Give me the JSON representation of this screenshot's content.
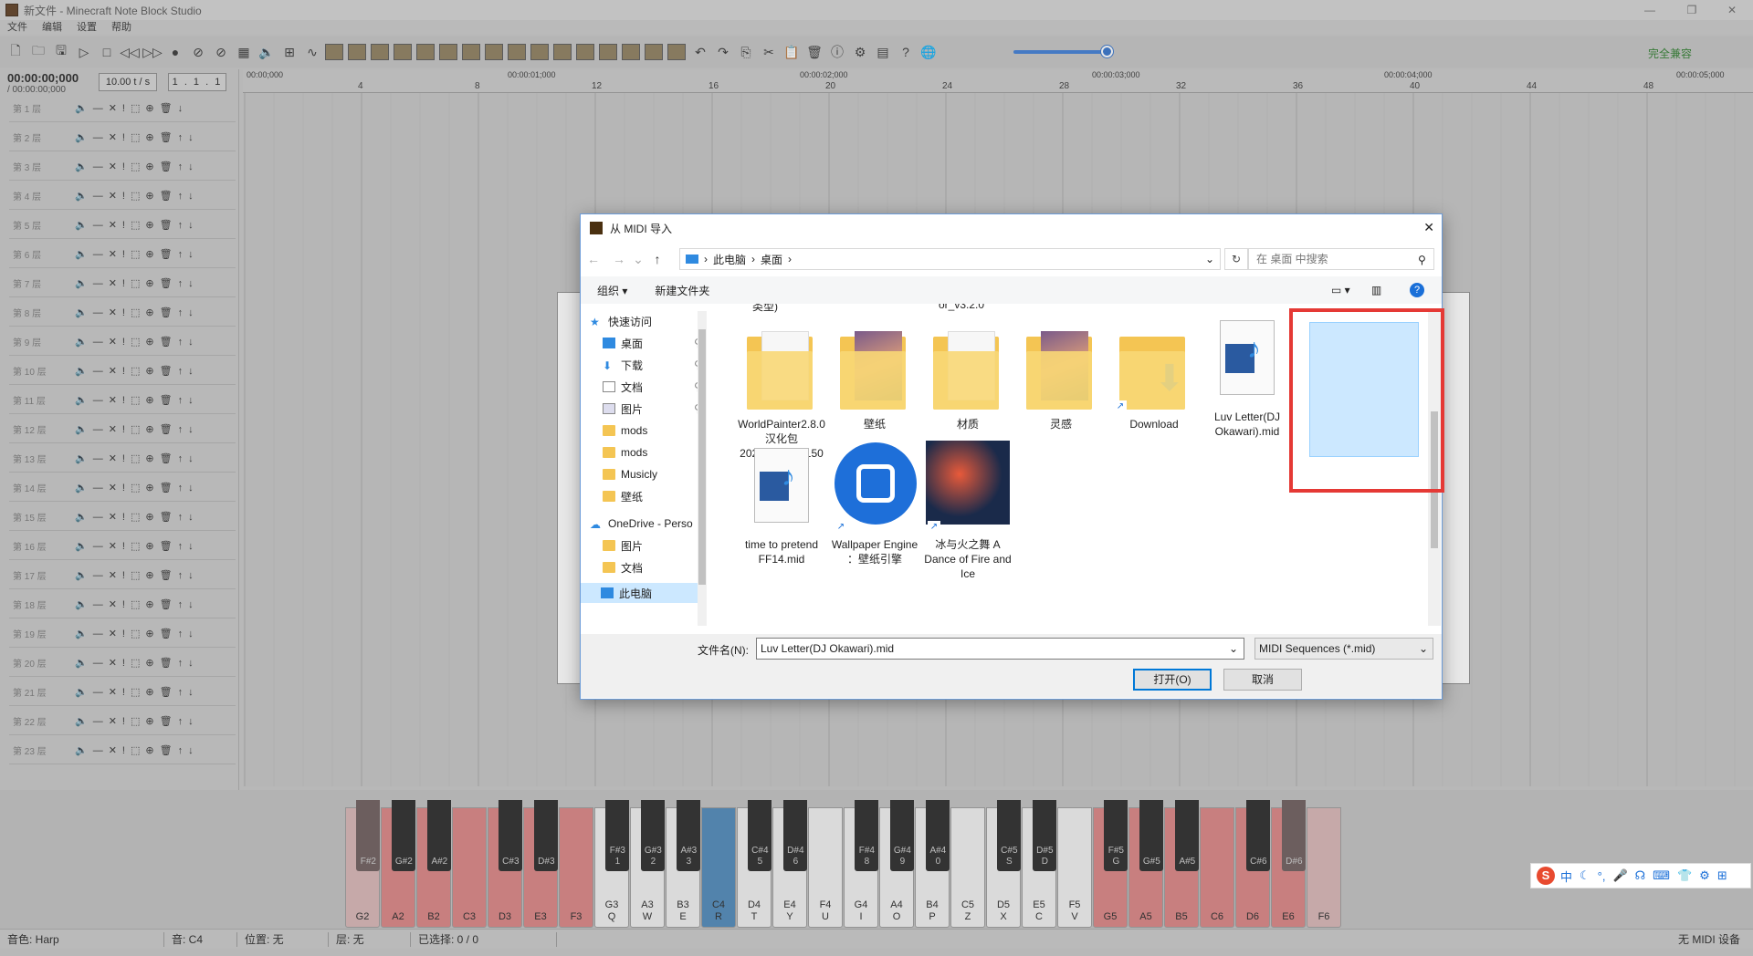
{
  "window": {
    "title": "新文件 - Minecraft Note Block Studio"
  },
  "menu": [
    "文件",
    "编辑",
    "设置",
    "帮助"
  ],
  "toolbar": {
    "compat": "完全兼容"
  },
  "song": {
    "time": "00:00:00;000",
    "total": "/ 00:00:00;000",
    "tempo": "10.00 t / s",
    "position": "1 . 1 . 1"
  },
  "layers": [
    "第 1 层",
    "第 2 层",
    "第 3 层",
    "第 4 层",
    "第 5 层",
    "第 6 层",
    "第 7 层",
    "第 8 层",
    "第 9 层",
    "第 10 层",
    "第 11 层",
    "第 12 层",
    "第 13 层",
    "第 14 层",
    "第 15 层",
    "第 16 层",
    "第 17 层",
    "第 18 层",
    "第 19 层",
    "第 20 层",
    "第 21 层",
    "第 22 层",
    "第 23 层"
  ],
  "ruler": {
    "times": [
      "00:00;000",
      "00:00:01;000",
      "00:00:02;000",
      "00:00:03;000",
      "00:00:04;000",
      "00:00:05;000"
    ],
    "ticks": [
      "4",
      "8",
      "12",
      "16",
      "20",
      "24",
      "28",
      "32",
      "36",
      "40",
      "44",
      "48"
    ]
  },
  "keyboard": {
    "white": [
      {
        "n": "G2",
        "k": ""
      },
      {
        "n": "A2",
        "k": ""
      },
      {
        "n": "B2",
        "k": ""
      },
      {
        "n": "C3",
        "k": ""
      },
      {
        "n": "D3",
        "k": ""
      },
      {
        "n": "E3",
        "k": ""
      },
      {
        "n": "F3",
        "k": ""
      },
      {
        "n": "G3",
        "k": "Q"
      },
      {
        "n": "A3",
        "k": "W"
      },
      {
        "n": "B3",
        "k": "E"
      },
      {
        "n": "C4",
        "k": "R"
      },
      {
        "n": "D4",
        "k": "T"
      },
      {
        "n": "E4",
        "k": "Y"
      },
      {
        "n": "F4",
        "k": "U"
      },
      {
        "n": "G4",
        "k": "I"
      },
      {
        "n": "A4",
        "k": "O"
      },
      {
        "n": "B4",
        "k": "P"
      },
      {
        "n": "C5",
        "k": "Z"
      },
      {
        "n": "D5",
        "k": "X"
      },
      {
        "n": "E5",
        "k": "C"
      },
      {
        "n": "F5",
        "k": "V"
      },
      {
        "n": "G5",
        "k": ""
      },
      {
        "n": "A5",
        "k": ""
      },
      {
        "n": "B5",
        "k": ""
      },
      {
        "n": "C6",
        "k": ""
      },
      {
        "n": "D6",
        "k": ""
      },
      {
        "n": "E6",
        "k": ""
      },
      {
        "n": "F6",
        "k": ""
      }
    ],
    "black": [
      {
        "n": "F#2",
        "k": ""
      },
      {
        "n": "G#2",
        "k": ""
      },
      {
        "n": "A#2",
        "k": ""
      },
      {
        "n": "C#3",
        "k": ""
      },
      {
        "n": "D#3",
        "k": ""
      },
      {
        "n": "F#3",
        "k": "1"
      },
      {
        "n": "G#3",
        "k": "2"
      },
      {
        "n": "A#3",
        "k": "3"
      },
      {
        "n": "C#4",
        "k": "5"
      },
      {
        "n": "D#4",
        "k": "6"
      },
      {
        "n": "F#4",
        "k": "8"
      },
      {
        "n": "G#4",
        "k": "9"
      },
      {
        "n": "A#4",
        "k": "0"
      },
      {
        "n": "C#5",
        "k": "S"
      },
      {
        "n": "D#5",
        "k": "D"
      },
      {
        "n": "F#5",
        "k": "G"
      },
      {
        "n": "G#5",
        "k": ""
      },
      {
        "n": "A#5",
        "k": ""
      },
      {
        "n": "C#6",
        "k": ""
      },
      {
        "n": "D#6",
        "k": ""
      }
    ]
  },
  "status": {
    "instrument": "音色: Harp",
    "key": "音: C4",
    "pos": "位置: 无",
    "layer": "层: 无",
    "selected": "已选择: 0 / 0",
    "midi": "无 MIDI 设备"
  },
  "dialog": {
    "title": "从 MIDI 导入",
    "breadcrumb": [
      "此电脑",
      "桌面"
    ],
    "search_placeholder": "在 桌面 中搜索",
    "organize": "组织 ▾",
    "new_folder": "新建文件夹",
    "nav": {
      "quick": "快速访问",
      "items": [
        "桌面",
        "下载",
        "文档",
        "图片",
        "mods",
        "mods",
        "Musicly",
        "壁纸"
      ],
      "onedrive": "OneDrive - Perso",
      "od_items": [
        "图片",
        "文档"
      ],
      "thispc": "此电脑"
    },
    "partial_labels": [
      "类型)",
      "or_v3.2.0"
    ],
    "files": [
      {
        "name": "WorldPainter2.8.0 汉化包 20210501110150"
      },
      {
        "name": "壁纸"
      },
      {
        "name": "材质"
      },
      {
        "name": "灵感"
      },
      {
        "name": "Download"
      },
      {
        "name": "Luv Letter(DJ Okawari).mid"
      },
      {
        "name": "time to pretend FF14.mid"
      },
      {
        "name": "Wallpaper Engine ：壁纸引擎"
      },
      {
        "name": "冰与火之舞 A Dance of Fire and Ice"
      }
    ],
    "filename_label": "文件名(N):",
    "filename_value": "Luv Letter(DJ Okawari).mid",
    "filetype": "MIDI Sequences (*.mid)",
    "open": "打开(O)",
    "cancel": "取消"
  },
  "ime": {
    "text": "中"
  }
}
